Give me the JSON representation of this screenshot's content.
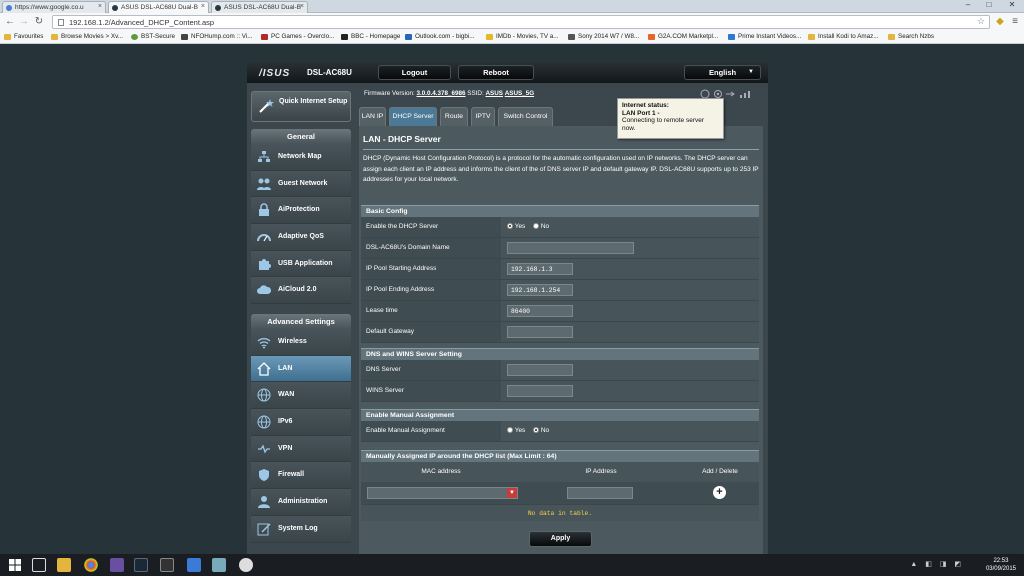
{
  "browser": {
    "tabs": [
      {
        "title": "https://www.google.co.u",
        "active": false
      },
      {
        "title": "ASUS DSL-AC68U Dual-B",
        "active": true
      },
      {
        "title": "ASUS DSL-AC68U Dual-B",
        "active": false
      }
    ],
    "url": "192.168.1.2/Advanced_DHCP_Content.asp",
    "bookmarks": [
      "Favourites",
      "Browse Movies > Xv...",
      "BST-Secure",
      "NFOHump.com :: Vi...",
      "PC Games - Overclo...",
      "BBC - Homepage",
      "Outlook.com - bigbi...",
      "IMDb - Movies, TV a...",
      "Sony 2014 W7 / W8...",
      "G2A.COM Marketpl...",
      "Prime Instant Videos...",
      "Install Kodi to Amaz...",
      "Search Nzbs"
    ]
  },
  "router": {
    "logo": "/ISUS",
    "model": "DSL-AC68U",
    "logout": "Logout",
    "reboot": "Reboot",
    "language": "English",
    "quick_setup": "Quick Internet Setup",
    "firmware_label": "Firmware Version:",
    "firmware": "3.0.0.4.378_6986",
    "ssid_label": "SSID:",
    "ssid1": "ASUS",
    "ssid2": "ASUS_5G",
    "tooltip": {
      "title": "Internet status:",
      "port": "LAN Port 1 -",
      "msg": "Connecting to remote server now."
    },
    "general_header": "General",
    "general_items": [
      "Network Map",
      "Guest Network",
      "AiProtection",
      "Adaptive QoS",
      "USB Application",
      "AiCloud 2.0"
    ],
    "advanced_header": "Advanced Settings",
    "advanced_items": [
      "Wireless",
      "LAN",
      "WAN",
      "IPv6",
      "VPN",
      "Firewall",
      "Administration",
      "System Log"
    ],
    "tabs": [
      "LAN IP",
      "DHCP Server",
      "Route",
      "IPTV",
      "Switch Control"
    ],
    "page_title": "LAN - DHCP Server",
    "description": "DHCP (Dynamic Host Configuration Protocol) is a protocol for the automatic configuration used on IP networks. The DHCP server can assign each client an IP address and informs the client of the of DNS server IP and default gateway IP. DSL-AC68U supports up to 253 IP addresses for your local network.",
    "basic_config": {
      "header": "Basic Config",
      "enable_label": "Enable the DHCP Server",
      "yes": "Yes",
      "no": "No",
      "domain_label": "DSL-AC68U's Domain Name",
      "domain_value": "",
      "start_label": "IP Pool Starting Address",
      "start_value": "192.168.1.3",
      "end_label": "IP Pool Ending Address",
      "end_value": "192.168.1.254",
      "lease_label": "Lease time",
      "lease_value": "86400",
      "gateway_label": "Default Gateway",
      "gateway_value": ""
    },
    "dns_wins": {
      "header": "DNS and WINS Server Setting",
      "dns_label": "DNS Server",
      "wins_label": "WINS Server"
    },
    "manual": {
      "header": "Enable Manual Assignment",
      "label": "Enable Manual Assignment",
      "yes": "Yes",
      "no": "No"
    },
    "manual_list": {
      "header": "Manually Assigned IP around the DHCP list (Max Limit : 64)",
      "col_mac": "MAC address",
      "col_ip": "IP Address",
      "col_add": "Add / Delete",
      "no_data": "No data in table."
    },
    "apply": "Apply"
  },
  "taskbar": {
    "time": "22:53",
    "date": "03/09/2015"
  }
}
